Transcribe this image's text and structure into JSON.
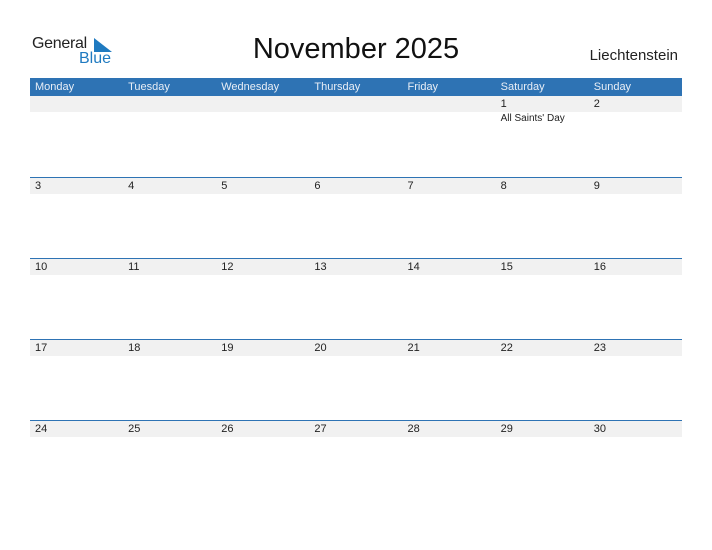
{
  "logo": {
    "line1": "General",
    "line2": "Blue",
    "accent": "#1f7ac0"
  },
  "title": "November 2025",
  "country": "Liechtenstein",
  "colors": {
    "header_bg": "#2e73b4",
    "date_band": "#f1f1f1"
  },
  "weekdays": [
    "Monday",
    "Tuesday",
    "Wednesday",
    "Thursday",
    "Friday",
    "Saturday",
    "Sunday"
  ],
  "weeks": [
    {
      "days": [
        "",
        "",
        "",
        "",
        "",
        "1",
        "2"
      ],
      "events": [
        "",
        "",
        "",
        "",
        "",
        "All Saints' Day",
        ""
      ]
    },
    {
      "days": [
        "3",
        "4",
        "5",
        "6",
        "7",
        "8",
        "9"
      ],
      "events": [
        "",
        "",
        "",
        "",
        "",
        "",
        ""
      ]
    },
    {
      "days": [
        "10",
        "11",
        "12",
        "13",
        "14",
        "15",
        "16"
      ],
      "events": [
        "",
        "",
        "",
        "",
        "",
        "",
        ""
      ]
    },
    {
      "days": [
        "17",
        "18",
        "19",
        "20",
        "21",
        "22",
        "23"
      ],
      "events": [
        "",
        "",
        "",
        "",
        "",
        "",
        ""
      ]
    },
    {
      "days": [
        "24",
        "25",
        "26",
        "27",
        "28",
        "29",
        "30"
      ],
      "events": [
        "",
        "",
        "",
        "",
        "",
        "",
        ""
      ]
    }
  ]
}
